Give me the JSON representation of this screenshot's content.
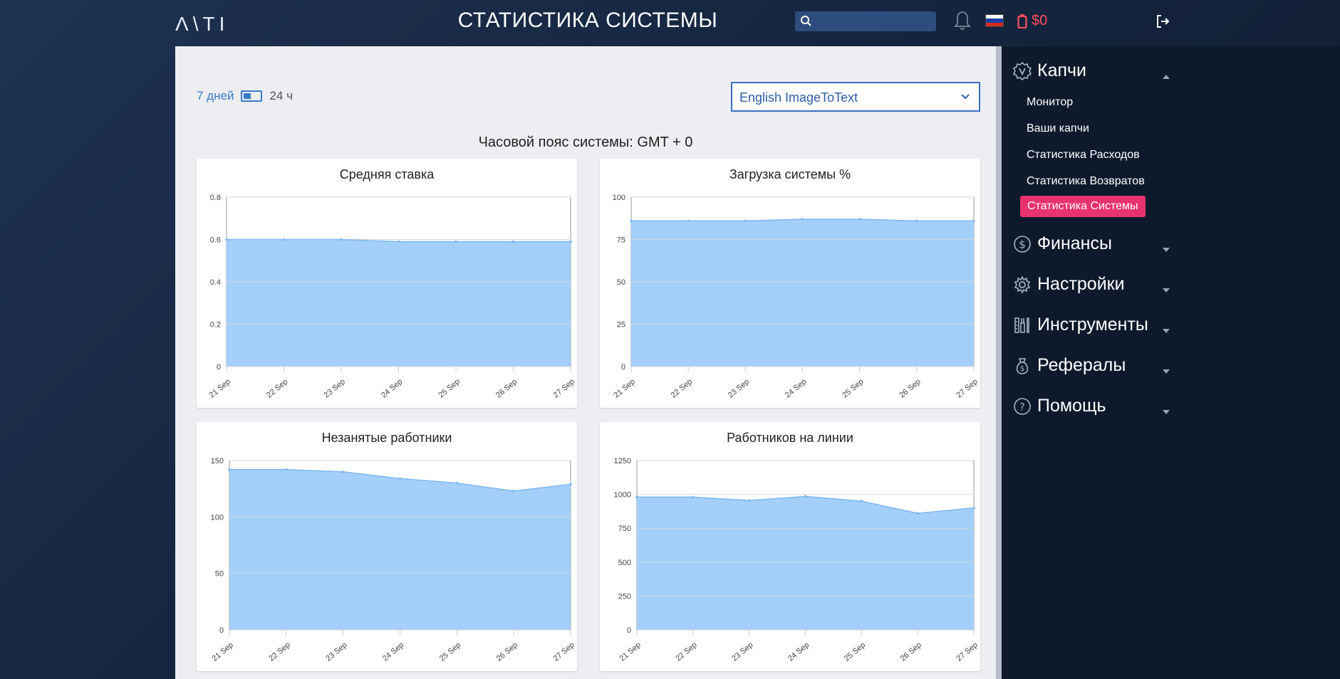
{
  "header": {
    "logo": "Λ\\TI",
    "title": "СТАТИСТИКА СИСТЕМЫ",
    "search_placeholder": "",
    "balance": "$0"
  },
  "controls": {
    "period_7d": "7 дней",
    "period_24h": "24 ч",
    "service_selected": "English ImageToText",
    "timezone": "Часовой пояс системы: GMT + 0"
  },
  "sidebar": {
    "sections": [
      {
        "label": "Капчи",
        "expanded": true,
        "icon": "captcha-badge-icon",
        "items": [
          "Монитор",
          "Ваши капчи",
          "Статистика Расходов",
          "Статистика Возвратов",
          "Статистика Системы"
        ],
        "active": "Статистика Системы"
      },
      {
        "label": "Финансы",
        "expanded": false,
        "icon": "dollar-circle-icon"
      },
      {
        "label": "Настройки",
        "expanded": false,
        "icon": "gear-icon"
      },
      {
        "label": "Инструменты",
        "expanded": false,
        "icon": "tools-icon"
      },
      {
        "label": "Рефералы",
        "expanded": false,
        "icon": "money-bag-icon"
      },
      {
        "label": "Помощь",
        "expanded": false,
        "icon": "help-circle-icon"
      }
    ]
  },
  "colors": {
    "accent": "#3a78c9",
    "active_item": "#e8336f",
    "area_fill": "#a3cffa",
    "area_line": "#7fb8f0",
    "balance": "#ff4f5e"
  },
  "chart_data": [
    {
      "type": "area",
      "title": "Средняя ставка",
      "x": [
        "21 Sep",
        "22 Sep",
        "23 Sep",
        "24 Sep",
        "25 Sep",
        "26 Sep",
        "27 Sep"
      ],
      "values": [
        0.6,
        0.6,
        0.6,
        0.59,
        0.59,
        0.59,
        0.59
      ],
      "yticks": [
        "0",
        "0.2",
        "0.4",
        "0.6",
        "0.8"
      ],
      "ylim": [
        0,
        0.8
      ],
      "grid": true
    },
    {
      "type": "area",
      "title": "Загрузка системы %",
      "x": [
        "21 Sep",
        "22 Sep",
        "23 Sep",
        "24 Sep",
        "25 Sep",
        "26 Sep",
        "27 Sep"
      ],
      "values": [
        86,
        86,
        86,
        87,
        87,
        86,
        86
      ],
      "yticks": [
        "0",
        "25",
        "50",
        "75",
        "100"
      ],
      "ylim": [
        0,
        100
      ],
      "grid": true
    },
    {
      "type": "area",
      "title": "Незанятые работники",
      "x": [
        "21 Sep",
        "22 Sep",
        "23 Sep",
        "24 Sep",
        "25 Sep",
        "26 Sep",
        "27 Sep"
      ],
      "values": [
        142,
        142,
        140,
        134,
        130,
        123,
        129
      ],
      "yticks": [
        "0",
        "50",
        "100",
        "150"
      ],
      "ylim": [
        0,
        150
      ],
      "grid": true
    },
    {
      "type": "area",
      "title": "Работников на линии",
      "x": [
        "21 Sep",
        "22 Sep",
        "23 Sep",
        "24 Sep",
        "25 Sep",
        "26 Sep",
        "27 Sep"
      ],
      "values": [
        980,
        980,
        955,
        985,
        950,
        860,
        900
      ],
      "yticks": [
        "0",
        "250",
        "500",
        "750",
        "1000",
        "1250"
      ],
      "ylim": [
        0,
        1250
      ],
      "grid": true
    }
  ]
}
